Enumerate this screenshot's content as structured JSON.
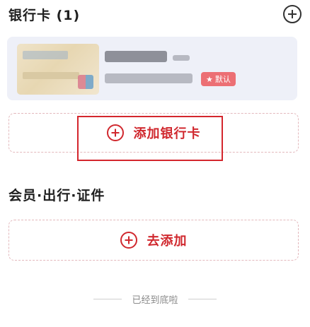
{
  "bank_section": {
    "title": "银行卡 (1)",
    "card": {
      "badge_icon": "star-icon",
      "badge_label": "默认"
    },
    "add_label": "添加银行卡"
  },
  "member_section": {
    "title": "会员·出行·证件",
    "add_label": "去添加"
  },
  "footer": {
    "text": "已经到底啦"
  },
  "colors": {
    "accent": "#d0282e",
    "badge": "#ec6f74",
    "card_panel": "#eef0f8",
    "dashed_border": "#e3b8bc"
  },
  "icons": {
    "header_add": "plus-circle-icon",
    "add_button": "plus-circle-icon"
  }
}
